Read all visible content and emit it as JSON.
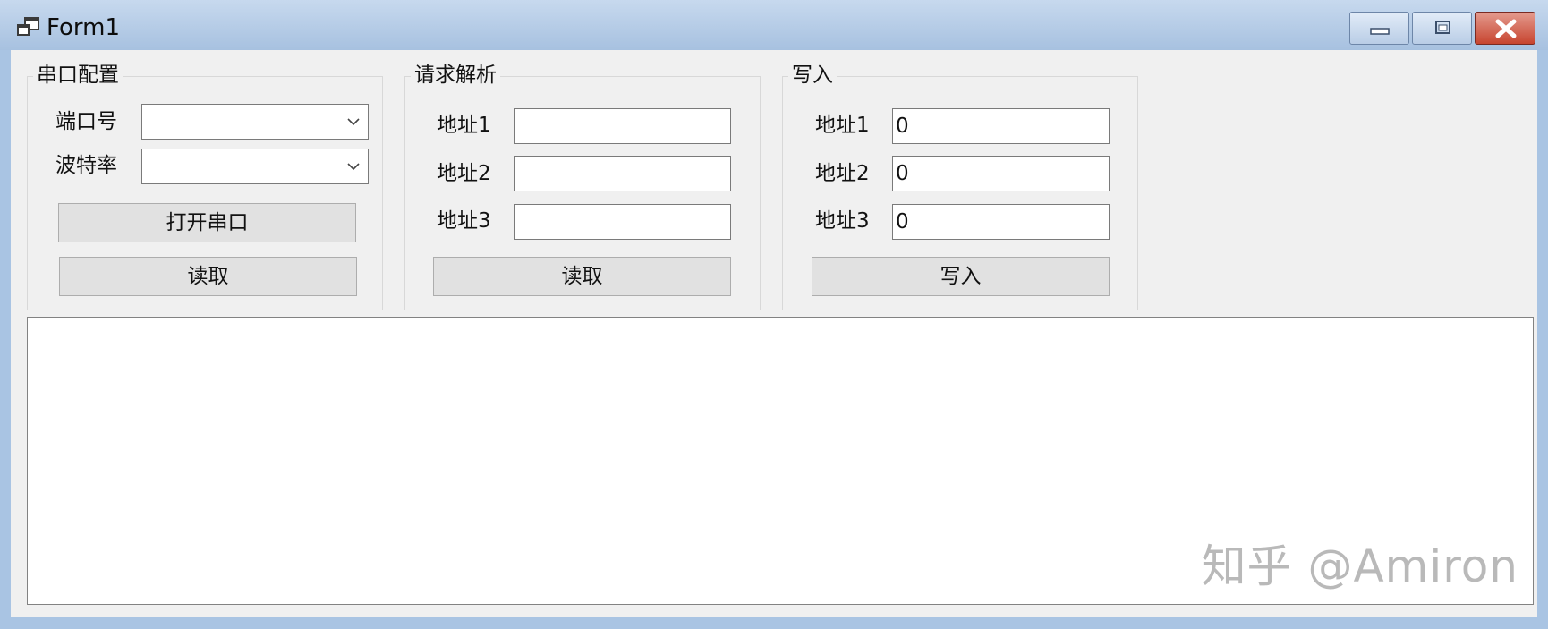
{
  "window": {
    "title": "Form1",
    "controls": [
      "minimize-icon",
      "maximize-icon",
      "close-icon"
    ]
  },
  "serial_config": {
    "title": "串口配置",
    "port_label": "端口号",
    "port_value": "",
    "baud_label": "波特率",
    "baud_value": "",
    "open_button": "打开串口",
    "read_button": "读取"
  },
  "request_parse": {
    "title": "请求解析",
    "fields": [
      {
        "label": "地址1",
        "value": ""
      },
      {
        "label": "地址2",
        "value": ""
      },
      {
        "label": "地址3",
        "value": ""
      }
    ],
    "read_button": "读取"
  },
  "write": {
    "title": "写入",
    "fields": [
      {
        "label": "地址1",
        "value": "0"
      },
      {
        "label": "地址2",
        "value": "0"
      },
      {
        "label": "地址3",
        "value": "0"
      }
    ],
    "write_button": "写入"
  },
  "output": {
    "text": ""
  },
  "watermark": "知乎 @Amiron"
}
